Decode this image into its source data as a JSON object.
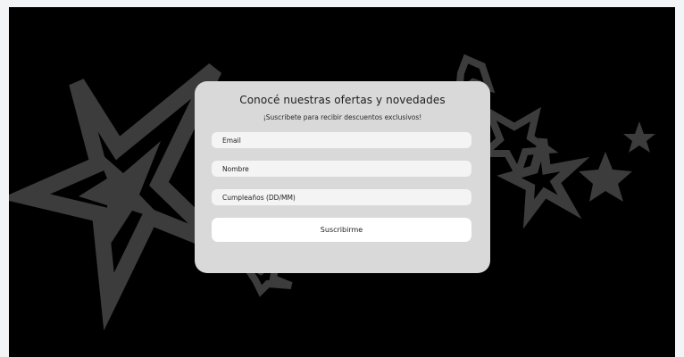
{
  "colors": {
    "background": "#000000",
    "stars": "#3c3c3c",
    "card": "#d9d9d9",
    "field": "#f4f4f4",
    "button": "#ffffff"
  },
  "popup": {
    "title": "Conocé nuestras ofertas y novedades",
    "subtitle": "¡Suscribete para recibir descuentos exclusivos!",
    "fields": {
      "email_placeholder": "Email",
      "name_placeholder": "Nombre",
      "birthday_placeholder": "Cumpleaños (DD/MM)"
    },
    "submit_label": "Suscribirme"
  },
  "background": {
    "decoration_icon": "star-icon"
  }
}
